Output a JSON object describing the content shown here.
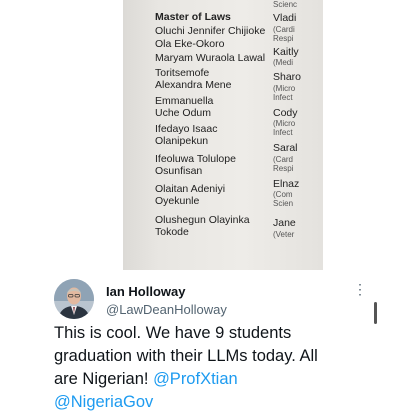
{
  "photo": {
    "section_heading": "Master of Laws",
    "graduates": [
      "Oluchi Jennifer Chijioke",
      "Ola Eke-Okoro",
      "Maryam Wuraola Lawal",
      "Toritsemofe",
      "Alexandra Mene",
      "Emmanuella",
      "Uche Odum",
      "Ifedayo Isaac",
      "Olanipekun",
      "Ifeoluwa Tolulope",
      "Osunfisan",
      "Olaitan Adeniyi",
      "Oyekunle",
      "Olushegun Olayinka",
      "Tokode"
    ],
    "right_column": [
      {
        "name": "Scienc",
        "sub": ""
      },
      {
        "name": "Vladi",
        "sub": "(Cardi"
      },
      {
        "name": "",
        "sub": "Respi"
      },
      {
        "name": "Kaitly",
        "sub": "(Medi"
      },
      {
        "name": "Sharo",
        "sub": "(Micro"
      },
      {
        "name": "",
        "sub": "Infect"
      },
      {
        "name": "Cody",
        "sub": "(Micro"
      },
      {
        "name": "",
        "sub": "Infect"
      },
      {
        "name": "Saral",
        "sub": "(Card"
      },
      {
        "name": "",
        "sub": "Respi"
      },
      {
        "name": "Elnaz",
        "sub": "(Com"
      },
      {
        "name": "",
        "sub": "Scien"
      },
      {
        "name": "Jane",
        "sub": "(Veter"
      }
    ]
  },
  "tweet": {
    "author_name": "Ian Holloway",
    "handle": "@LawDeanHolloway",
    "more_icon": "more-dots-icon",
    "text_lines": [
      "This is cool. We have 9 students",
      "graduation with their LLMs today. All",
      "are Nigerian!"
    ],
    "mention_1": "@ProfXtian",
    "mention_2": "@NigeriaGov"
  }
}
